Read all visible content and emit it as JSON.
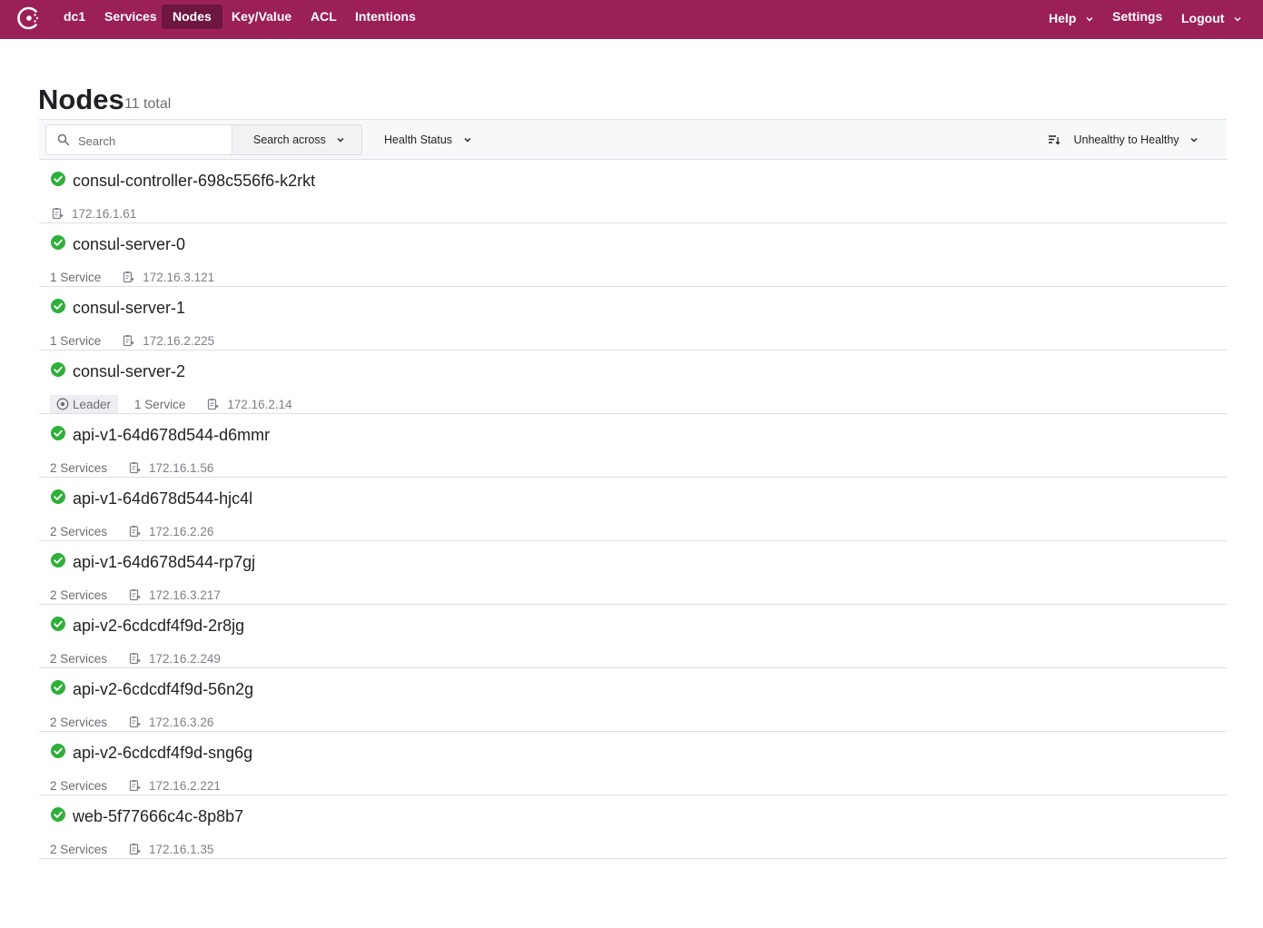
{
  "nav": {
    "items": [
      {
        "label": "dc1"
      },
      {
        "label": "Services"
      },
      {
        "label": "Nodes"
      },
      {
        "label": "Key/Value"
      },
      {
        "label": "ACL"
      },
      {
        "label": "Intentions"
      }
    ],
    "right": {
      "help": "Help",
      "settings": "Settings",
      "logout": "Logout"
    },
    "active": "Nodes",
    "brand_color": "#9b2057",
    "active_color": "#6d1640"
  },
  "page": {
    "title": "Nodes",
    "count": "11 total"
  },
  "filters": {
    "search_placeholder": "Search",
    "search_value": "",
    "search_across": "Search across",
    "health_status": "Health Status",
    "sort": "Unhealthy to Healthy"
  },
  "nodes": [
    {
      "name": "consul-controller-698c556f6-k2rkt",
      "leader": "",
      "services": "",
      "address": "172.16.1.61",
      "status": "passing"
    },
    {
      "name": "consul-server-0",
      "leader": "",
      "services": "1 Service",
      "address": "172.16.3.121",
      "status": "passing"
    },
    {
      "name": "consul-server-1",
      "leader": "",
      "services": "1 Service",
      "address": "172.16.2.225",
      "status": "passing"
    },
    {
      "name": "consul-server-2",
      "leader": "Leader",
      "services": "1 Service",
      "address": "172.16.2.14",
      "status": "passing"
    },
    {
      "name": "api-v1-64d678d544-d6mmr",
      "leader": "",
      "services": "2 Services",
      "address": "172.16.1.56",
      "status": "passing"
    },
    {
      "name": "api-v1-64d678d544-hjc4l",
      "leader": "",
      "services": "2 Services",
      "address": "172.16.2.26",
      "status": "passing"
    },
    {
      "name": "api-v1-64d678d544-rp7gj",
      "leader": "",
      "services": "2 Services",
      "address": "172.16.3.217",
      "status": "passing"
    },
    {
      "name": "api-v2-6cdcdf4f9d-2r8jg",
      "leader": "",
      "services": "2 Services",
      "address": "172.16.2.249",
      "status": "passing"
    },
    {
      "name": "api-v2-6cdcdf4f9d-56n2g",
      "leader": "",
      "services": "2 Services",
      "address": "172.16.3.26",
      "status": "passing"
    },
    {
      "name": "api-v2-6cdcdf4f9d-sng6g",
      "leader": "",
      "services": "2 Services",
      "address": "172.16.2.221",
      "status": "passing"
    },
    {
      "name": "web-5f77666c4c-8p8b7",
      "leader": "",
      "services": "2 Services",
      "address": "172.16.1.35",
      "status": "passing"
    }
  ],
  "colors": {
    "passing": "#2eb039",
    "text_muted": "#6a6d73",
    "border": "#dcdfe4"
  }
}
